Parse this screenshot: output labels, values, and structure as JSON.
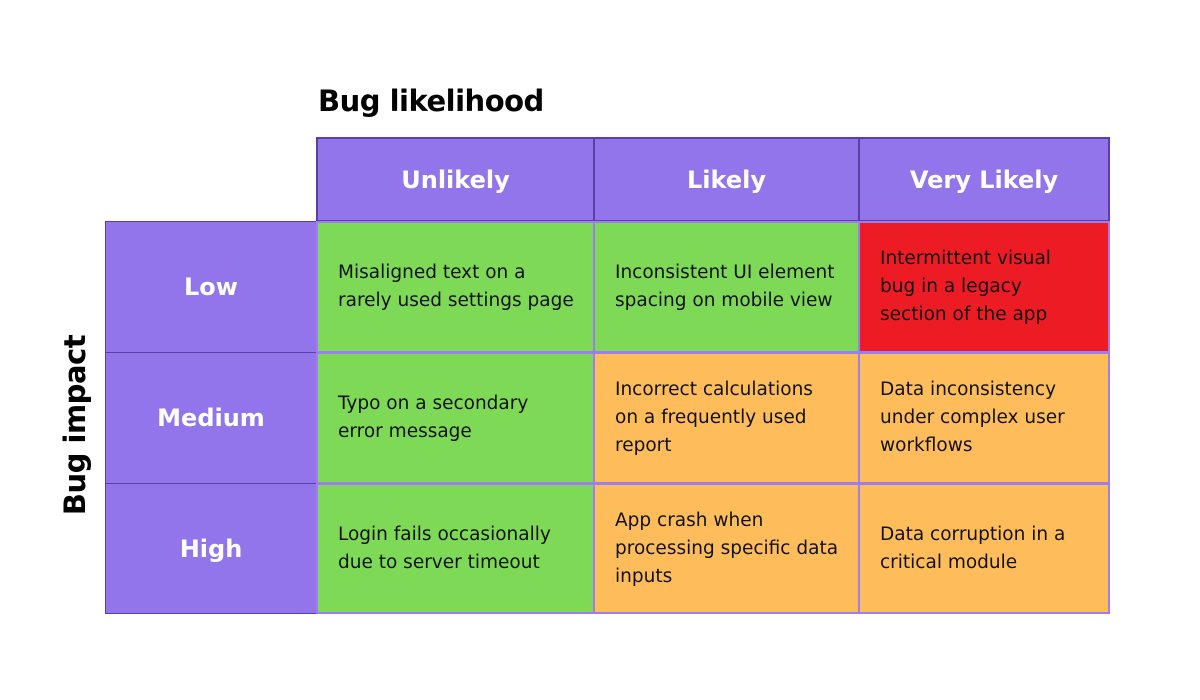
{
  "titles": {
    "x_axis": "Bug likelihood",
    "y_axis": "Bug impact"
  },
  "columns": [
    "Unlikely",
    "Likely",
    "Very Likely"
  ],
  "rows": [
    "Low",
    "Medium",
    "High"
  ],
  "colors": {
    "header": "#9274eb",
    "low_risk": "#7ed957",
    "medium_risk": "#ffbc5a",
    "high_risk": "#ed1c24"
  },
  "cells": [
    [
      {
        "text": "Misaligned text on a rarely used settings page",
        "level": "low"
      },
      {
        "text": "Inconsistent UI element spacing on mobile view",
        "level": "low"
      },
      {
        "text": "Intermittent visual bug in a legacy section of the app",
        "level": "high"
      }
    ],
    [
      {
        "text": "Typo on a secondary error message",
        "level": "low"
      },
      {
        "text": "Incorrect calculations on a frequently used report",
        "level": "medium"
      },
      {
        "text": "Data inconsistency under complex user workflows",
        "level": "medium"
      }
    ],
    [
      {
        "text": "Login fails occasionally due to server timeout",
        "level": "low"
      },
      {
        "text": "App crash when processing specific data inputs",
        "level": "medium"
      },
      {
        "text": "Data corruption in a critical module",
        "level": "medium"
      }
    ]
  ]
}
